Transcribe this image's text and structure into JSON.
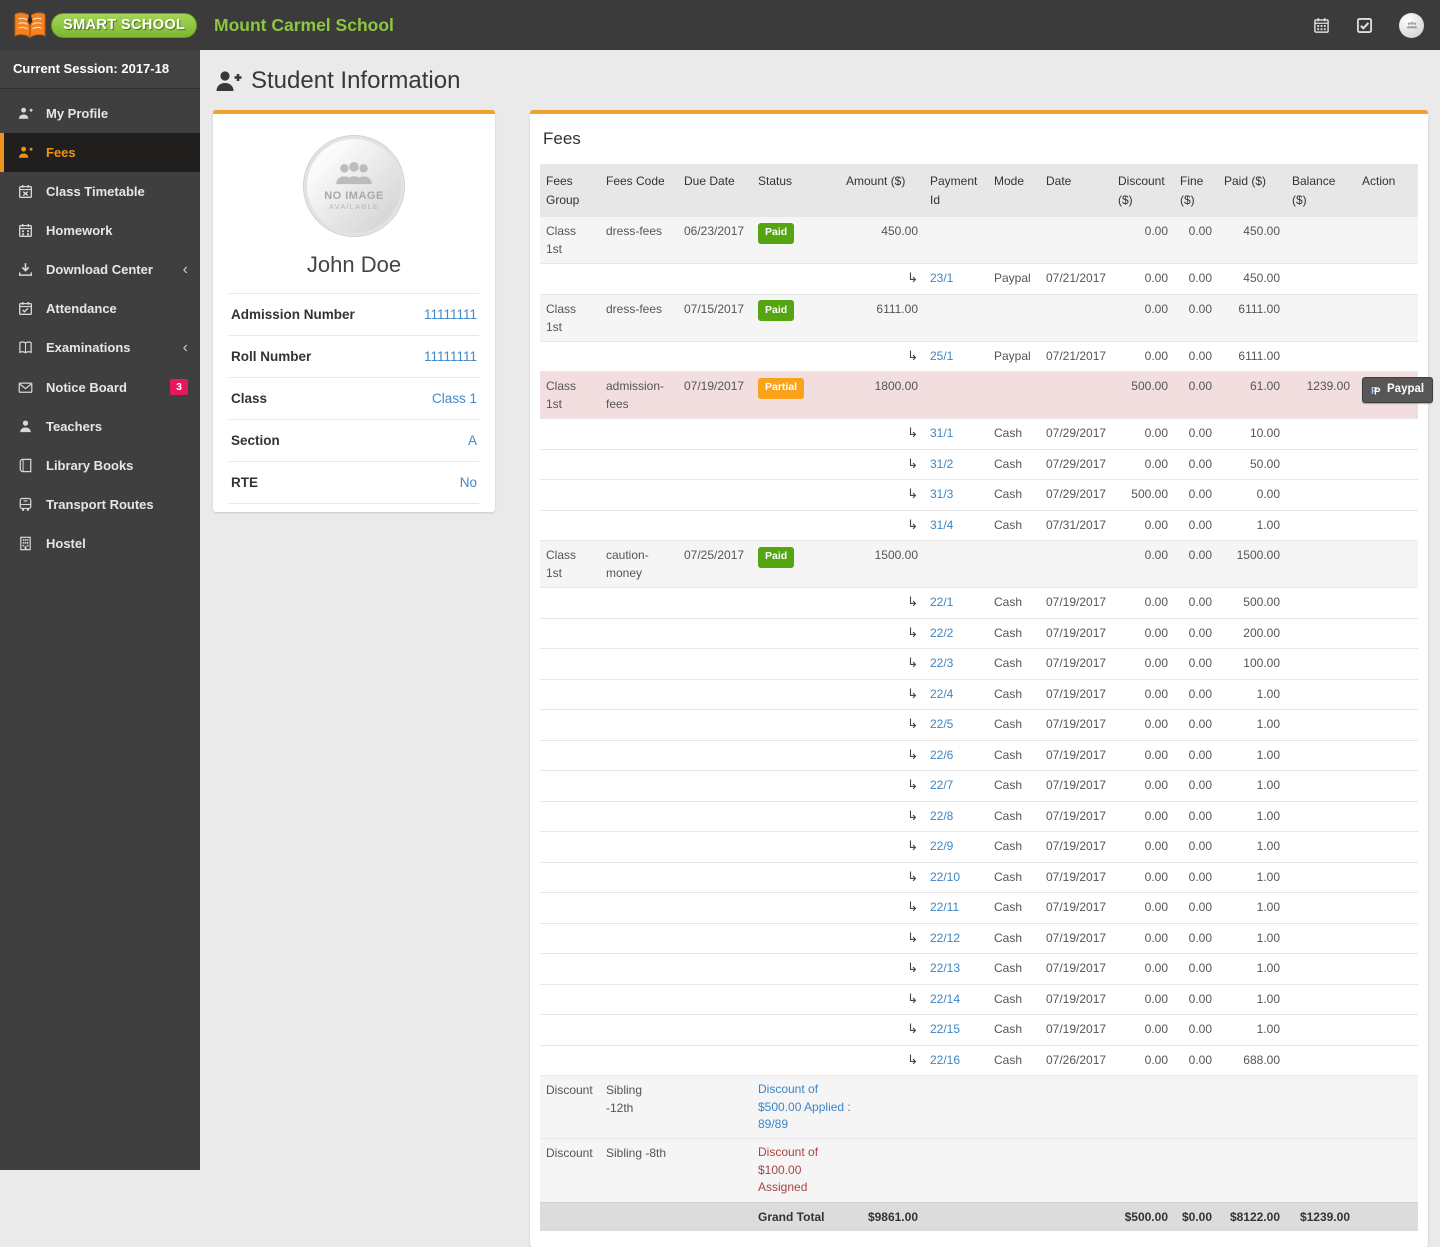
{
  "header": {
    "logo_text": "SMART SCHOOL",
    "school_name": "Mount Carmel School",
    "icons": [
      {
        "name": "calendar-icon"
      },
      {
        "name": "tasks-icon"
      },
      {
        "name": "user-avatar"
      }
    ]
  },
  "sidebar": {
    "session_label": "Current Session: 2017-18",
    "items": [
      {
        "label": "My Profile",
        "icon": "user-plus",
        "active": false
      },
      {
        "label": "Fees",
        "icon": "user-plus",
        "active": true
      },
      {
        "label": "Class Timetable",
        "icon": "calendar-x",
        "active": false
      },
      {
        "label": "Homework",
        "icon": "calendar-dots",
        "active": false
      },
      {
        "label": "Download Center",
        "icon": "download",
        "active": false,
        "chevron": true
      },
      {
        "label": "Attendance",
        "icon": "calendar-check",
        "active": false
      },
      {
        "label": "Examinations",
        "icon": "book-open",
        "active": false,
        "chevron": true
      },
      {
        "label": "Notice Board",
        "icon": "envelope",
        "active": false,
        "badge": "3"
      },
      {
        "label": "Teachers",
        "icon": "user",
        "active": false
      },
      {
        "label": "Library Books",
        "icon": "book",
        "active": false
      },
      {
        "label": "Transport Routes",
        "icon": "bus",
        "active": false
      },
      {
        "label": "Hostel",
        "icon": "building",
        "active": false
      }
    ]
  },
  "page": {
    "title": "Student Information"
  },
  "student": {
    "photo_placeholder_line1": "NO IMAGE",
    "photo_placeholder_line2": "AVAILABLE",
    "name": "John Doe",
    "details": [
      {
        "label": "Admission Number",
        "value": "11111111"
      },
      {
        "label": "Roll Number",
        "value": "11111111"
      },
      {
        "label": "Class",
        "value": "Class 1"
      },
      {
        "label": "Section",
        "value": "A"
      },
      {
        "label": "RTE",
        "value": "No"
      }
    ]
  },
  "fees": {
    "panel_title": "Fees",
    "columns": [
      "Fees Group",
      "Fees Code",
      "Due Date",
      "Status",
      "Amount ($)",
      "Payment Id",
      "Mode",
      "Date",
      "Discount ($)",
      "Fine ($)",
      "Paid ($)",
      "Balance ($)",
      "Action"
    ],
    "colors": {
      "paid_badge": "#55a512",
      "partial_badge": "#f9a21a",
      "partial_row_bg": "#f2dede",
      "accent_orange": "#f0a12e",
      "link_blue": "#3d85c6",
      "note_red": "#a94442"
    },
    "rows": [
      {
        "type": "fee",
        "group": "Class 1st",
        "code": "dress-fees",
        "due": "06/23/2017",
        "status": "Paid",
        "amount": "450.00",
        "discount": "0.00",
        "fine": "0.00",
        "paid": "450.00",
        "balance": "",
        "action": ""
      },
      {
        "type": "payment",
        "id": "23/1",
        "mode": "Paypal",
        "date": "07/21/2017",
        "discount": "0.00",
        "fine": "0.00",
        "paid": "450.00"
      },
      {
        "type": "fee",
        "group": "Class 1st",
        "code": "dress-fees",
        "due": "07/15/2017",
        "status": "Paid",
        "amount": "6111.00",
        "discount": "0.00",
        "fine": "0.00",
        "paid": "6111.00",
        "balance": "",
        "action": ""
      },
      {
        "type": "payment",
        "id": "25/1",
        "mode": "Paypal",
        "date": "07/21/2017",
        "discount": "0.00",
        "fine": "0.00",
        "paid": "6111.00"
      },
      {
        "type": "fee",
        "group": "Class 1st",
        "code": "admission-fees",
        "due": "07/19/2017",
        "status": "Partial",
        "amount": "1800.00",
        "discount": "500.00",
        "fine": "0.00",
        "paid": "61.00",
        "balance": "1239.00",
        "action": "Paypal",
        "highlight": true
      },
      {
        "type": "payment",
        "id": "31/1",
        "mode": "Cash",
        "date": "07/29/2017",
        "discount": "0.00",
        "fine": "0.00",
        "paid": "10.00"
      },
      {
        "type": "payment",
        "id": "31/2",
        "mode": "Cash",
        "date": "07/29/2017",
        "discount": "0.00",
        "fine": "0.00",
        "paid": "50.00"
      },
      {
        "type": "payment",
        "id": "31/3",
        "mode": "Cash",
        "date": "07/29/2017",
        "discount": "500.00",
        "fine": "0.00",
        "paid": "0.00"
      },
      {
        "type": "payment",
        "id": "31/4",
        "mode": "Cash",
        "date": "07/31/2017",
        "discount": "0.00",
        "fine": "0.00",
        "paid": "1.00"
      },
      {
        "type": "fee",
        "group": "Class 1st",
        "code": "caution-money",
        "due": "07/25/2017",
        "status": "Paid",
        "amount": "1500.00",
        "discount": "0.00",
        "fine": "0.00",
        "paid": "1500.00",
        "balance": "",
        "action": ""
      },
      {
        "type": "payment",
        "id": "22/1",
        "mode": "Cash",
        "date": "07/19/2017",
        "discount": "0.00",
        "fine": "0.00",
        "paid": "500.00"
      },
      {
        "type": "payment",
        "id": "22/2",
        "mode": "Cash",
        "date": "07/19/2017",
        "discount": "0.00",
        "fine": "0.00",
        "paid": "200.00"
      },
      {
        "type": "payment",
        "id": "22/3",
        "mode": "Cash",
        "date": "07/19/2017",
        "discount": "0.00",
        "fine": "0.00",
        "paid": "100.00"
      },
      {
        "type": "payment",
        "id": "22/4",
        "mode": "Cash",
        "date": "07/19/2017",
        "discount": "0.00",
        "fine": "0.00",
        "paid": "1.00"
      },
      {
        "type": "payment",
        "id": "22/5",
        "mode": "Cash",
        "date": "07/19/2017",
        "discount": "0.00",
        "fine": "0.00",
        "paid": "1.00"
      },
      {
        "type": "payment",
        "id": "22/6",
        "mode": "Cash",
        "date": "07/19/2017",
        "discount": "0.00",
        "fine": "0.00",
        "paid": "1.00"
      },
      {
        "type": "payment",
        "id": "22/7",
        "mode": "Cash",
        "date": "07/19/2017",
        "discount": "0.00",
        "fine": "0.00",
        "paid": "1.00"
      },
      {
        "type": "payment",
        "id": "22/8",
        "mode": "Cash",
        "date": "07/19/2017",
        "discount": "0.00",
        "fine": "0.00",
        "paid": "1.00"
      },
      {
        "type": "payment",
        "id": "22/9",
        "mode": "Cash",
        "date": "07/19/2017",
        "discount": "0.00",
        "fine": "0.00",
        "paid": "1.00"
      },
      {
        "type": "payment",
        "id": "22/10",
        "mode": "Cash",
        "date": "07/19/2017",
        "discount": "0.00",
        "fine": "0.00",
        "paid": "1.00"
      },
      {
        "type": "payment",
        "id": "22/11",
        "mode": "Cash",
        "date": "07/19/2017",
        "discount": "0.00",
        "fine": "0.00",
        "paid": "1.00"
      },
      {
        "type": "payment",
        "id": "22/12",
        "mode": "Cash",
        "date": "07/19/2017",
        "discount": "0.00",
        "fine": "0.00",
        "paid": "1.00"
      },
      {
        "type": "payment",
        "id": "22/13",
        "mode": "Cash",
        "date": "07/19/2017",
        "discount": "0.00",
        "fine": "0.00",
        "paid": "1.00"
      },
      {
        "type": "payment",
        "id": "22/14",
        "mode": "Cash",
        "date": "07/19/2017",
        "discount": "0.00",
        "fine": "0.00",
        "paid": "1.00"
      },
      {
        "type": "payment",
        "id": "22/15",
        "mode": "Cash",
        "date": "07/19/2017",
        "discount": "0.00",
        "fine": "0.00",
        "paid": "1.00"
      },
      {
        "type": "payment",
        "id": "22/16",
        "mode": "Cash",
        "date": "07/26/2017",
        "discount": "0.00",
        "fine": "0.00",
        "paid": "688.00"
      },
      {
        "type": "discount",
        "group": "Discount",
        "code": "Sibling -12th",
        "note": "Discount of\n$500.00 Applied :\n89/89",
        "note_color": "blue"
      },
      {
        "type": "discount",
        "group": "Discount",
        "code": "Sibling -8th",
        "note": "Discount of\n$100.00\nAssigned",
        "note_color": "red"
      },
      {
        "type": "total",
        "label": "Grand Total",
        "amount": "$9861.00",
        "discount": "$500.00",
        "fine": "$0.00",
        "paid": "$8122.00",
        "balance": "$1239.00"
      }
    ]
  }
}
